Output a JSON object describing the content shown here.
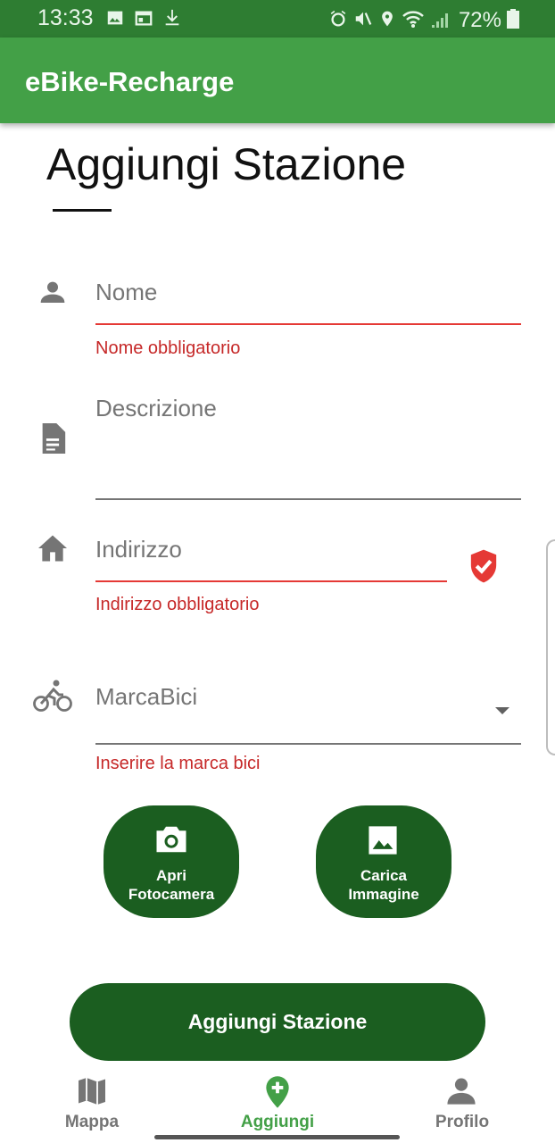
{
  "status_bar": {
    "time": "13:33",
    "battery": "72%"
  },
  "app_bar": {
    "title": "eBike-Recharge"
  },
  "page": {
    "title": "Aggiungi Stazione"
  },
  "form": {
    "nome": {
      "label": "Nome",
      "error": "Nome obbligatorio",
      "icon": "person-icon"
    },
    "descrizione": {
      "label": "Descrizione",
      "icon": "document-icon"
    },
    "indirizzo": {
      "label": "Indirizzo",
      "error": "Indirizzo obbligatorio",
      "icon": "home-icon"
    },
    "marca_bici": {
      "label": "MarcaBici",
      "error": "Inserire la marca bici",
      "icon": "bike-icon"
    }
  },
  "actions": {
    "camera_label": "Apri Fotocamera",
    "upload_label": "Carica Immagine",
    "submit_label": "Aggiungi Stazione"
  },
  "bottom_nav": {
    "items": [
      {
        "label": "Mappa",
        "icon": "map-icon",
        "active": false
      },
      {
        "label": "Aggiungi",
        "icon": "add-location-icon",
        "active": true
      },
      {
        "label": "Profilo",
        "icon": "person-icon",
        "active": false
      }
    ]
  },
  "colors": {
    "status_bar": "#2e7d32",
    "app_bar": "#43a047",
    "button": "#1b5e20",
    "error": "#c62828",
    "active_nav": "#43a047",
    "inactive_nav": "#757575"
  }
}
